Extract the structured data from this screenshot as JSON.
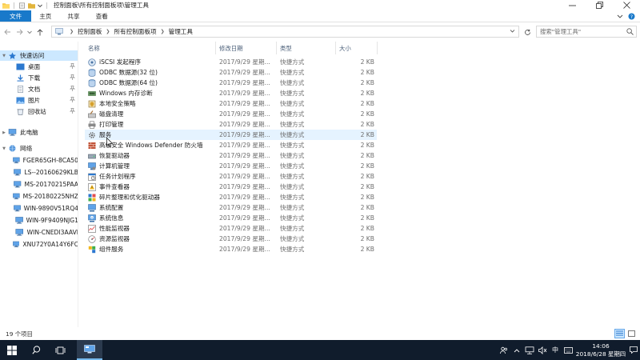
{
  "window": {
    "title": "控制面板\\所有控制面板项\\管理工具"
  },
  "ribbon": {
    "tabs": [
      "文件",
      "主页",
      "共享",
      "查看"
    ]
  },
  "address": {
    "crumbs": [
      "控制面板",
      "所有控制面板项",
      "管理工具"
    ],
    "search_placeholder": "搜索\"管理工具\""
  },
  "sidebar": {
    "items": [
      {
        "label": "快速访问",
        "icon": "star-icon"
      },
      {
        "label": "桌面",
        "icon": "desktop-icon",
        "pinned": true
      },
      {
        "label": "下载",
        "icon": "download-icon",
        "pinned": true
      },
      {
        "label": "文档",
        "icon": "document-icon",
        "pinned": true
      },
      {
        "label": "图片",
        "icon": "pictures-icon",
        "pinned": true
      },
      {
        "label": "回收站",
        "icon": "recycle-bin-icon",
        "pinned": true
      },
      {
        "label": "此电脑",
        "icon": "computer-icon"
      },
      {
        "label": "网络",
        "icon": "network-icon"
      },
      {
        "label": "FGER65GH-8CA50",
        "icon": "computer-icon"
      },
      {
        "label": "LS--20160629KLB",
        "icon": "computer-icon"
      },
      {
        "label": "MS-20170215PAA",
        "icon": "computer-icon"
      },
      {
        "label": "MS-20180225NHZ",
        "icon": "computer-icon"
      },
      {
        "label": "WIN-9890V51RQ4",
        "icon": "computer-icon"
      },
      {
        "label": "WIN-9F9409NJG1",
        "icon": "computer-icon"
      },
      {
        "label": "WIN-CNEDI3AAVI",
        "icon": "computer-icon"
      },
      {
        "label": "XNU72Y0A14Y6FC",
        "icon": "computer-icon"
      }
    ]
  },
  "columns": {
    "name": "名称",
    "date": "修改日期",
    "type": "类型",
    "size": "大小"
  },
  "files": [
    {
      "name": "iSCSI 发起程序",
      "date": "2017/9/29 星期...",
      "type": "快捷方式",
      "size": "2 KB"
    },
    {
      "name": "ODBC 数据源(32 位)",
      "date": "2017/9/29 星期...",
      "type": "快捷方式",
      "size": "2 KB"
    },
    {
      "name": "ODBC 数据源(64 位)",
      "date": "2017/9/29 星期...",
      "type": "快捷方式",
      "size": "2 KB"
    },
    {
      "name": "Windows 内存诊断",
      "date": "2017/9/29 星期...",
      "type": "快捷方式",
      "size": "2 KB"
    },
    {
      "name": "本地安全策略",
      "date": "2017/9/29 星期...",
      "type": "快捷方式",
      "size": "2 KB"
    },
    {
      "name": "磁盘清理",
      "date": "2017/9/29 星期...",
      "type": "快捷方式",
      "size": "2 KB"
    },
    {
      "name": "打印管理",
      "date": "2017/9/29 星期...",
      "type": "快捷方式",
      "size": "2 KB"
    },
    {
      "name": "服务",
      "date": "2017/9/29 星期...",
      "type": "快捷方式",
      "size": "2 KB"
    },
    {
      "name": "高级安全 Windows Defender 防火墙",
      "date": "2017/9/29 星期...",
      "type": "快捷方式",
      "size": "2 KB"
    },
    {
      "name": "恢复驱动器",
      "date": "2017/9/29 星期...",
      "type": "快捷方式",
      "size": "2 KB"
    },
    {
      "name": "计算机管理",
      "date": "2017/9/29 星期...",
      "type": "快捷方式",
      "size": "2 KB"
    },
    {
      "name": "任务计划程序",
      "date": "2017/9/29 星期...",
      "type": "快捷方式",
      "size": "2 KB"
    },
    {
      "name": "事件查看器",
      "date": "2017/9/29 星期...",
      "type": "快捷方式",
      "size": "2 KB"
    },
    {
      "name": "碎片整理和优化驱动器",
      "date": "2017/9/29 星期...",
      "type": "快捷方式",
      "size": "2 KB"
    },
    {
      "name": "系统配置",
      "date": "2017/9/29 星期...",
      "type": "快捷方式",
      "size": "2 KB"
    },
    {
      "name": "系统信息",
      "date": "2017/9/29 星期...",
      "type": "快捷方式",
      "size": "2 KB"
    },
    {
      "name": "性能监视器",
      "date": "2017/9/29 星期...",
      "type": "快捷方式",
      "size": "2 KB"
    },
    {
      "name": "资源监视器",
      "date": "2017/9/29 星期...",
      "type": "快捷方式",
      "size": "2 KB"
    },
    {
      "name": "组件服务",
      "date": "2017/9/29 星期...",
      "type": "快捷方式",
      "size": "2 KB"
    }
  ],
  "hovered_file": "服务",
  "status": {
    "count": "19 个项目"
  },
  "taskbar": {
    "ime": "中",
    "time": "14:06",
    "date": "2018/6/28 星期四"
  },
  "colors": {
    "accent": "#1979ca",
    "selection": "#cce8ff",
    "hover": "#e5f3ff",
    "taskbar": "#101c2c"
  }
}
